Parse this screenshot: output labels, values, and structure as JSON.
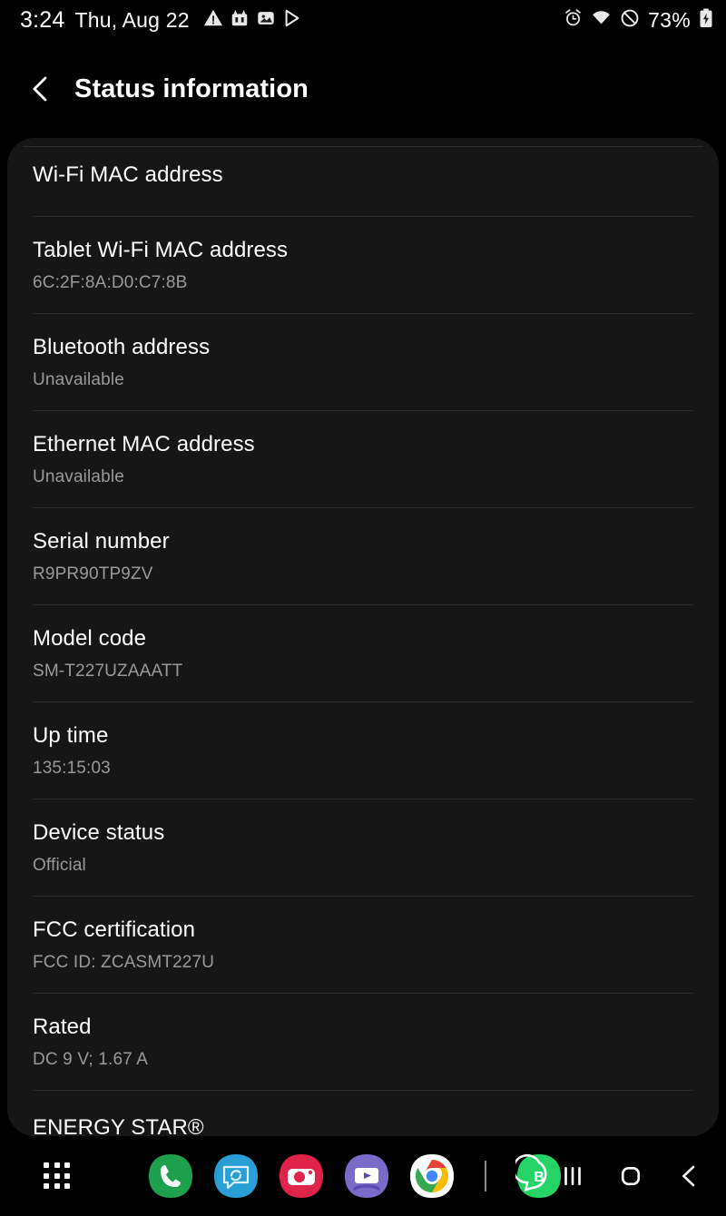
{
  "statusbar": {
    "time": "3:24",
    "date": "Thu, Aug 22",
    "battery_percent": "73%",
    "left_icons": [
      "warning-triangle-icon",
      "game-app-icon",
      "image-icon",
      "play-store-icon"
    ],
    "right_icons": [
      "alarm-icon",
      "wifi-icon",
      "do-not-disturb-icon",
      "battery-charging-icon"
    ]
  },
  "appbar": {
    "back_label": "Back",
    "title": "Status information"
  },
  "list": {
    "rows": [
      {
        "title": "Wi-Fi MAC address",
        "value": ""
      },
      {
        "title": "Tablet Wi-Fi MAC address",
        "value": "6C:2F:8A:D0:C7:8B"
      },
      {
        "title": "Bluetooth address",
        "value": "Unavailable"
      },
      {
        "title": "Ethernet MAC address",
        "value": "Unavailable"
      },
      {
        "title": "Serial number",
        "value": "R9PR90TP9ZV"
      },
      {
        "title": "Model code",
        "value": "SM-T227UZAAATT"
      },
      {
        "title": "Up time",
        "value": "135:15:03"
      },
      {
        "title": "Device status",
        "value": "Official"
      },
      {
        "title": "FCC certification",
        "value": "FCC ID: ZCASMT227U"
      },
      {
        "title": "Rated",
        "value": "DC 9 V; 1.67 A"
      },
      {
        "title": "ENERGY STAR®",
        "value": ""
      }
    ]
  },
  "dock": {
    "app_drawer_label": "Apps",
    "apps": [
      {
        "name": "phone-app-icon",
        "label": "Phone",
        "color": "#1ea14f"
      },
      {
        "name": "messages-app-icon",
        "label": "Messages",
        "color": "#2a9fd6"
      },
      {
        "name": "camera-app-icon",
        "label": "Camera",
        "color": "#e0234a"
      },
      {
        "name": "video-player-app-icon",
        "label": "Video Player",
        "color": "#7b6bc9"
      },
      {
        "name": "chrome-app-icon",
        "label": "Chrome",
        "color": "#ffffff"
      },
      {
        "name": "whatsapp-business-app-icon",
        "label": "WhatsApp Business",
        "color": "#25d366"
      }
    ],
    "nav": [
      {
        "name": "recents-button",
        "label": "Recents"
      },
      {
        "name": "home-button",
        "label": "Home"
      },
      {
        "name": "back-button",
        "label": "Back"
      }
    ]
  },
  "colors": {
    "background": "#000000",
    "card": "#161616",
    "divider": "#2b2b2b",
    "title_text": "#ffffff",
    "value_text": "#9a9a9a"
  }
}
